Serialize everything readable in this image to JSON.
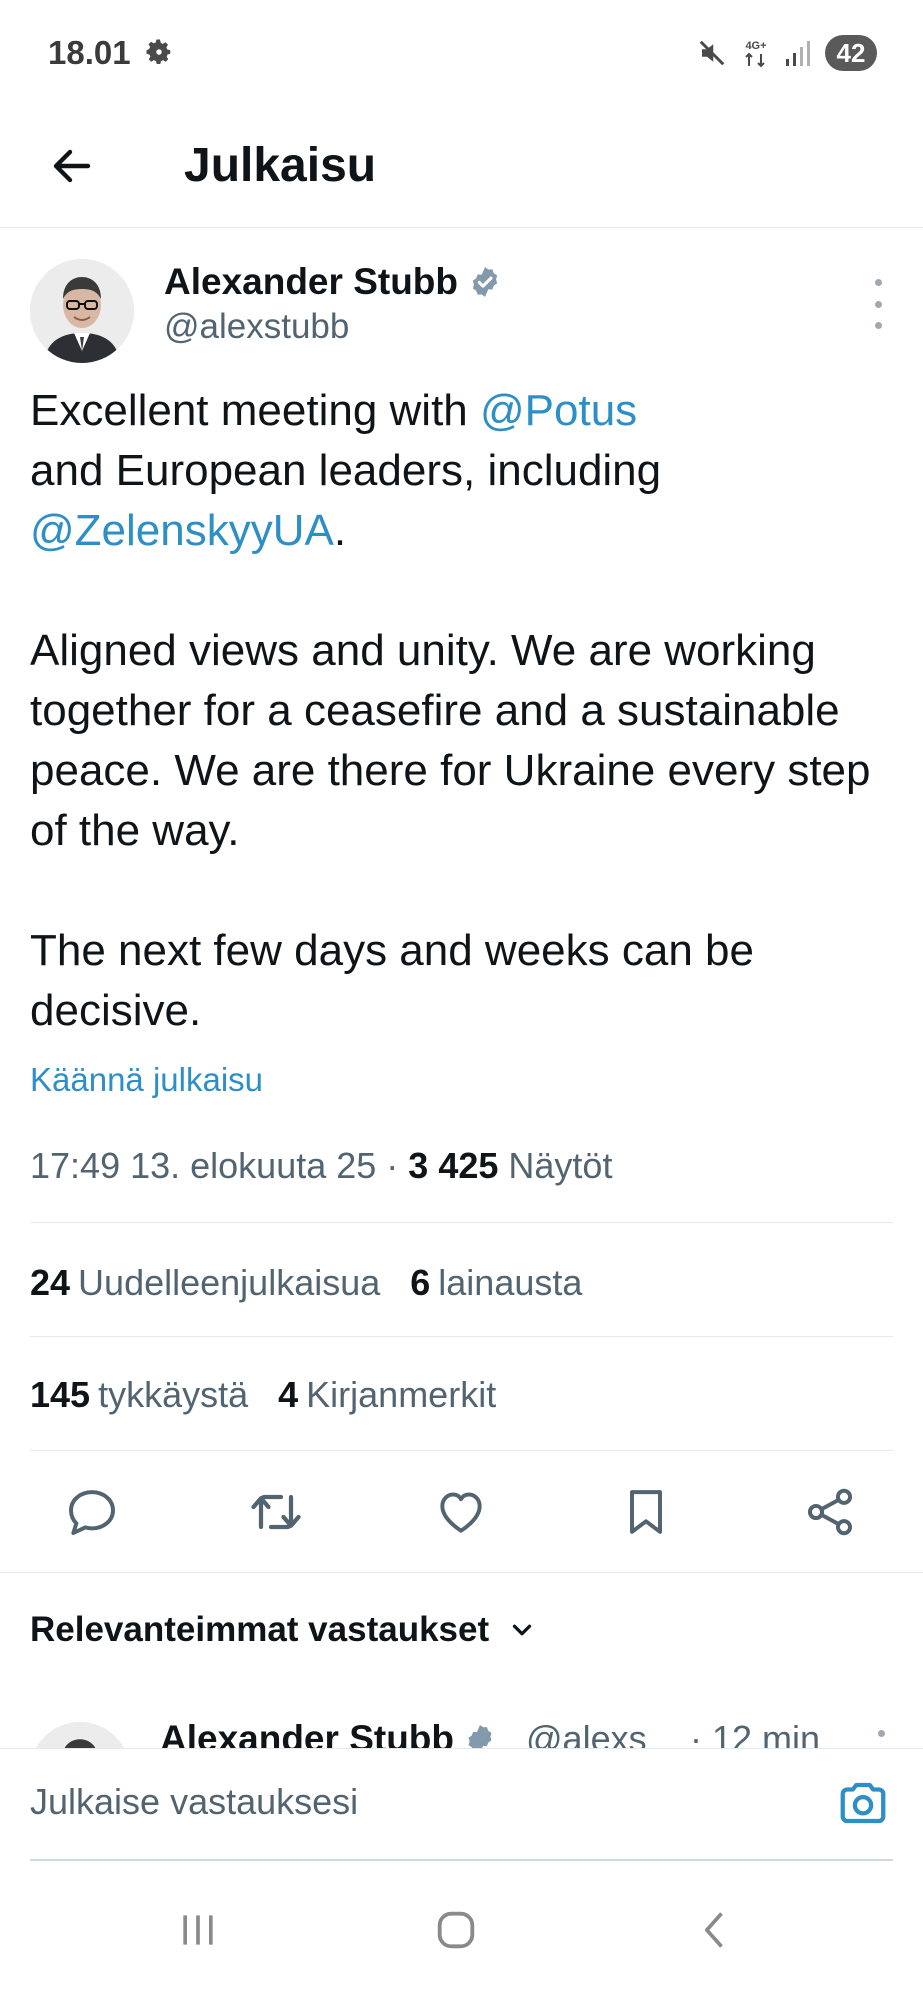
{
  "status_bar": {
    "time": "18.01",
    "network": "4G+",
    "battery": "42",
    "icons": [
      "gear-icon",
      "mute-icon",
      "network-icon",
      "signal-icon",
      "battery-icon"
    ]
  },
  "app_bar": {
    "title": "Julkaisu",
    "back_icon": "arrow-left-icon"
  },
  "tweet": {
    "author_name": "Alexander Stubb",
    "handle": "@alexstubb",
    "verified_icon": "verified-badge-icon",
    "text": {
      "line1_prefix": "Excellent meeting with ",
      "mention1": "@Potus",
      "line2": "and European leaders, including",
      "mention2": "@ZelenskyyUA",
      "line3_suffix": ".",
      "paragraph2": "Aligned views and unity. We are working together for a ceasefire and a sustainable peace. We are there for Ukraine every step of the way.",
      "paragraph3": "The next few days and weeks can be decisive."
    },
    "translate_label": "Käännä julkaisu",
    "timestamp": "17:49 13. elokuuta 25",
    "separator": " · ",
    "views_count": "3 425",
    "views_label": "Näytöt",
    "stats": {
      "reposts_count": "24",
      "reposts_label": "Uudelleenjulkaisua",
      "quotes_count": "6",
      "quotes_label": "lainausta",
      "likes_count": "145",
      "likes_label": "tykkäystä",
      "bookmarks_count": "4",
      "bookmarks_label": "Kirjanmerkit"
    },
    "actions": [
      "reply-icon",
      "repost-icon",
      "like-icon",
      "bookmark-icon",
      "share-icon"
    ]
  },
  "replies": {
    "sort_label": "Relevanteimmat vastaukset",
    "peek": {
      "author_name": "Alexander Stubb",
      "handle": "@alexs",
      "time": "· 12 min"
    }
  },
  "composer": {
    "placeholder": "Julkaise vastauksesi",
    "camera_icon": "camera-icon"
  },
  "nav_bar": [
    "recents-icon",
    "home-icon",
    "back-icon"
  ],
  "colors": {
    "link": "#2e8fc7",
    "secondary_text": "#536471",
    "primary_text": "#0f1419",
    "divider": "#e6e9ec"
  }
}
